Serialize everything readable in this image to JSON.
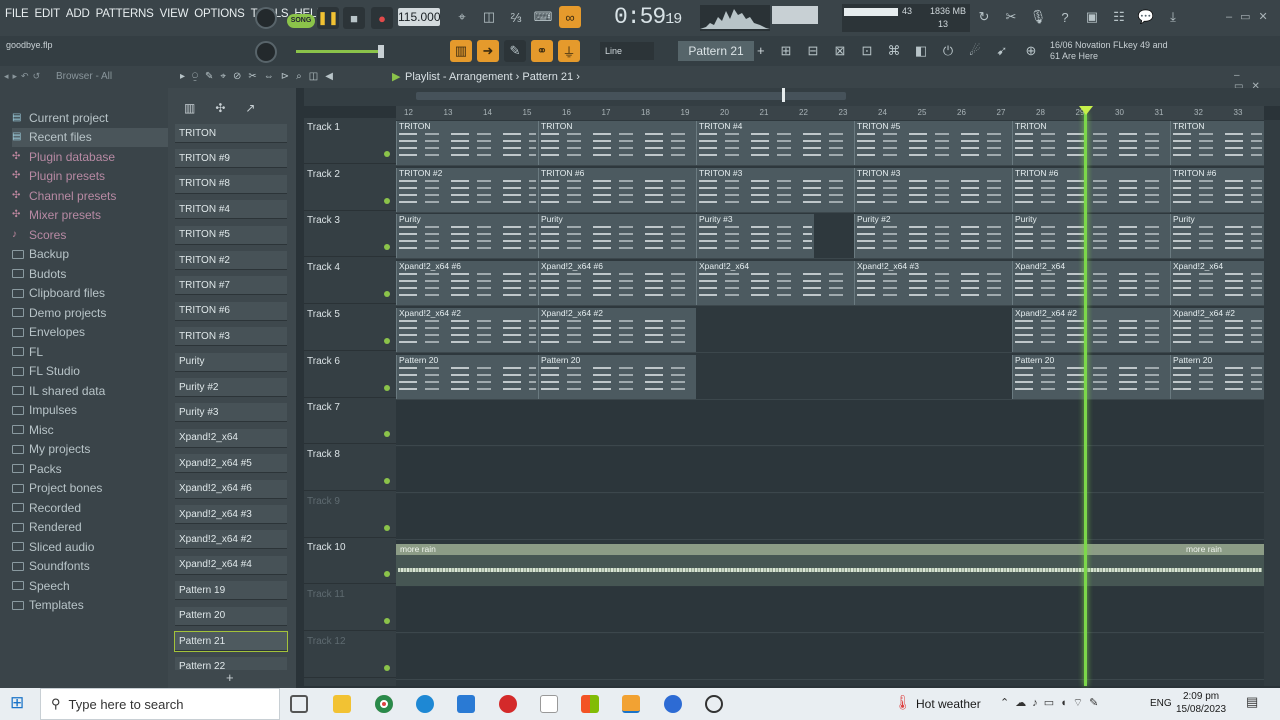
{
  "menu": [
    "FILE",
    "EDIT",
    "ADD",
    "PATTERNS",
    "VIEW",
    "OPTIONS",
    "TOOLS",
    "HELP"
  ],
  "transport": {
    "mode": "SONG",
    "bpm": "115.000",
    "time": "0:59",
    "time_sub": "19",
    "cpu": "43",
    "memory": "1836 MB",
    "voices": "13"
  },
  "project_file": "goodbye.flp",
  "snap": "Line",
  "pattern_selector": "Pattern 21",
  "hint": {
    "line1": "16/06  Novation FLkey 49 and",
    "line2": "61 Are Here"
  },
  "browser": {
    "title": "Browser - All",
    "items": [
      "Current project",
      "Recent files",
      "Plugin database",
      "Plugin presets",
      "Channel presets",
      "Mixer presets",
      "Scores",
      "Backup",
      "Budots",
      "Clipboard files",
      "Demo projects",
      "Envelopes",
      "FL",
      "FL Studio",
      "IL shared data",
      "Impulses",
      "Misc",
      "My projects",
      "Packs",
      "Project bones",
      "Recorded",
      "Rendered",
      "Sliced audio",
      "Soundfonts",
      "Speech",
      "Templates"
    ]
  },
  "patterns": [
    "TRITON",
    "TRITON #9",
    "TRITON #8",
    "TRITON #4",
    "TRITON #5",
    "TRITON #2",
    "TRITON #7",
    "TRITON #6",
    "TRITON #3",
    "Purity",
    "Purity #2",
    "Purity #3",
    "Xpand!2_x64",
    "Xpand!2_x64 #5",
    "Xpand!2_x64 #6",
    "Xpand!2_x64 #3",
    "Xpand!2_x64 #2",
    "Xpand!2_x64 #4",
    "Pattern 19",
    "Pattern 20",
    "Pattern 21",
    "Pattern 22"
  ],
  "playlist": {
    "title": "Playlist - Arrangement",
    "current_pattern": "Pattern 21"
  },
  "ruler": [
    "12",
    "13",
    "14",
    "15",
    "16",
    "17",
    "18",
    "19",
    "20",
    "21",
    "22",
    "23",
    "24",
    "25",
    "26",
    "27",
    "28",
    "29",
    "30",
    "31",
    "32",
    "33"
  ],
  "tracks": [
    "Track 1",
    "Track 2",
    "Track 3",
    "Track 4",
    "Track 5",
    "Track 6",
    "Track 7",
    "Track 8",
    "Track 9",
    "Track 10",
    "Track 11",
    "Track 12"
  ],
  "clips": [
    [
      "TRITON",
      "TRITON",
      "TRITON #4",
      "TRITON #5",
      "TRITON",
      "TRITON"
    ],
    [
      "TRITON #2",
      "TRITON #6",
      "TRITON #3",
      "TRITON #3",
      "TRITON #6",
      "TRITON #6"
    ],
    [
      "Purity",
      "Purity",
      "Purity #3",
      "Purity #2",
      "Purity",
      "Purity"
    ],
    [
      "Xpand!2_x64 #6",
      "Xpand!2_x64 #6",
      "Xpand!2_x64",
      "Xpand!2_x64 #3",
      "Xpand!2_x64",
      "Xpand!2_x64"
    ],
    [
      "Xpand!2_x64 #2",
      "Xpand!2_x64 #2",
      "Xpand!2_x64 #2",
      "Xpand!2_x64 #2"
    ],
    [
      "Pattern 20",
      "Pattern 20",
      "Pattern 20",
      "Pattern 20"
    ]
  ],
  "audio_clip": {
    "name": "more rain",
    "name2": "more rain"
  },
  "taskbar": {
    "search_placeholder": "Type here to search",
    "weather": "Hot weather",
    "lang": "ENG",
    "time": "2:09 pm",
    "date": "15/08/2023"
  },
  "colors": {
    "accent": "#e59a2c",
    "playhead": "#7cd84a",
    "selected": "#a3c23a"
  }
}
